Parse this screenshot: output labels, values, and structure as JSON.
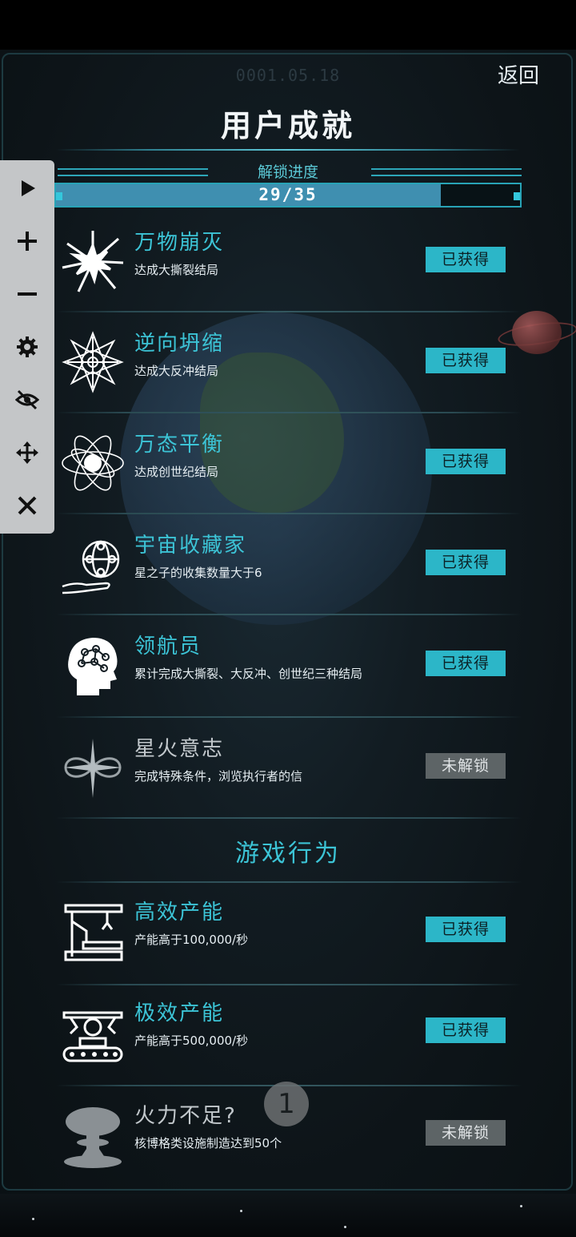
{
  "header": {
    "date": "0001.05.18",
    "back_label": "返回",
    "title": "用户成就"
  },
  "progress": {
    "label": "解锁进度",
    "text": "29/35",
    "unlocked": 29,
    "total": 35
  },
  "achievements": [
    {
      "name": "万物崩灭",
      "desc": "达成大撕裂结局",
      "status": "已获得",
      "icon": "starburst-icon"
    },
    {
      "name": "逆向坍缩",
      "desc": "达成大反冲结局",
      "status": "已获得",
      "icon": "mandala-icon"
    },
    {
      "name": "万态平衡",
      "desc": "达成创世纪结局",
      "status": "已获得",
      "icon": "atom-icon"
    },
    {
      "name": "宇宙收藏家",
      "desc": "星之子的收集数量大于6",
      "status": "已获得",
      "icon": "hand-globe-icon"
    },
    {
      "name": "领航员",
      "desc": "累计完成大撕裂、大反冲、创世纪三种结局",
      "status": "已获得",
      "icon": "brain-head-icon"
    },
    {
      "name": "星火意志",
      "desc": "完成特殊条件，浏览执行者的信",
      "status": "未解锁",
      "icon": "infinity-star-icon"
    }
  ],
  "section_title": "游戏行为",
  "behaviors": [
    {
      "name": "高效产能",
      "desc": "产能高于100,000/秒",
      "status": "已获得",
      "icon": "factory-arm-icon"
    },
    {
      "name": "极效产能",
      "desc": "产能高于500,000/秒",
      "status": "已获得",
      "icon": "factory-conveyor-icon"
    },
    {
      "name": "火力不足?",
      "desc": "核博格类设施制造达到50个",
      "status": "未解锁",
      "icon": "mushroom-cloud-icon"
    }
  ],
  "toolbar": [
    {
      "icon": "play-icon"
    },
    {
      "icon": "plus-icon"
    },
    {
      "icon": "minus-icon"
    },
    {
      "icon": "gear-icon"
    },
    {
      "icon": "eye-off-icon"
    },
    {
      "icon": "move-icon"
    },
    {
      "icon": "close-icon"
    }
  ],
  "floating_button": {
    "label": "1"
  },
  "colors": {
    "accent": "#3cc4d6",
    "badge_obtained": "#2cb6c8",
    "badge_locked": "#5d6466",
    "progress_fill": "#3f8fb0"
  }
}
